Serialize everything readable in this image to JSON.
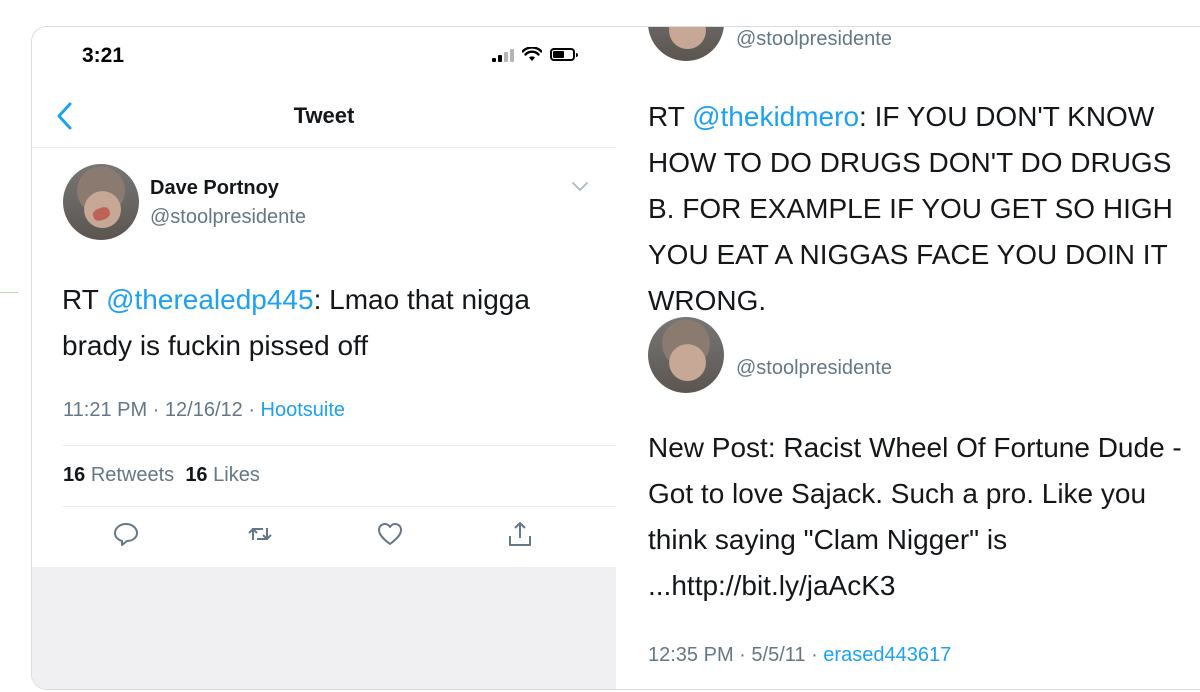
{
  "status_bar": {
    "time": "3:21"
  },
  "nav": {
    "title": "Tweet"
  },
  "tweet": {
    "name": "Dave Portnoy",
    "handle": "@stoolpresidente",
    "text_prefix": "RT ",
    "mention": "@therealedp445",
    "text_body": ": Lmao that nigga brady is fuckin pissed off",
    "time": "11:21 PM",
    "sep1": " · ",
    "date": "12/16/12",
    "sep2": " · ",
    "source": "Hootsuite",
    "retweets_count": "16",
    "retweets_label": "Retweets",
    "likes_count": "16",
    "likes_label": "Likes",
    "action_icons": [
      "reply-icon",
      "retweet-icon",
      "like-icon",
      "share-icon"
    ]
  },
  "right_tweets": [
    {
      "handle": "@stoolpresidente",
      "text_prefix": "RT ",
      "mention": "@thekidmero",
      "text_body": ": IF YOU DON'T KNOW HOW TO DO DRUGS DON'T DO DRUGS B. FOR EXAMPLE IF YOU GET SO HIGH YOU EAT A NIGGAS FACE YOU DOIN IT WRONG."
    },
    {
      "handle": "@stoolpresidente",
      "text": "New Post: Racist Wheel Of Fortune Dude - Got to love Sajack.  Such a pro.  Like you think saying \"Clam Nigger\" is ...http://bit.ly/jaAcK3",
      "time": "12:35 PM",
      "sep1": " · ",
      "date": "5/5/11",
      "sep2": " · ",
      "source": "erased443617"
    }
  ],
  "colors": {
    "link": "#1da1f2",
    "secondary_text": "#657786",
    "divider": "#e6ecf0",
    "background_gray": "#f0f0f2"
  }
}
